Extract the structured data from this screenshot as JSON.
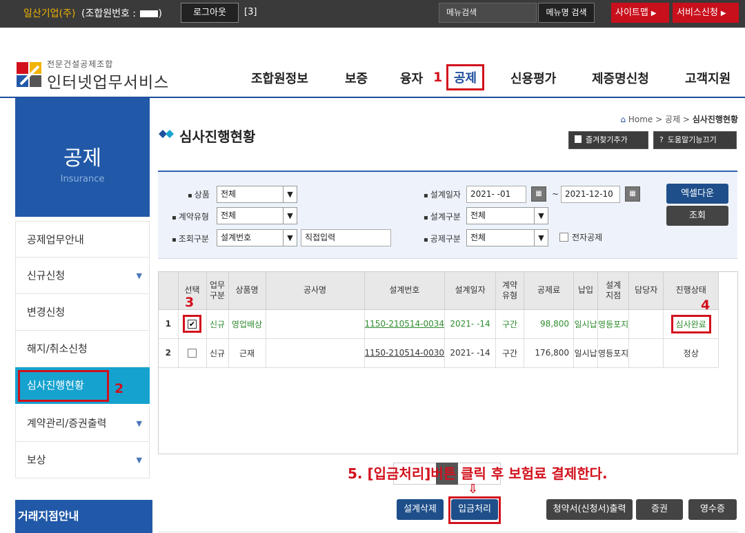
{
  "topbar": {
    "company": "일산기업(주)",
    "member_label": "(조합원번호 :",
    "logout": "로그아웃",
    "count": "[3]",
    "menu_search_placeholder": "메뉴검색",
    "menu_search_button": "메뉴명 검색",
    "sitemap": "사이트맵",
    "service": "서비스신청"
  },
  "logo": {
    "sub": "전문건설공제조합",
    "main": "인터넷업무서비스"
  },
  "gnav": [
    "조합원정보",
    "보증",
    "융자",
    "공제",
    "신용평가",
    "제증명신청",
    "고객지원"
  ],
  "annotations": {
    "n1": "1",
    "n2": "2",
    "n3": "3",
    "n4": "4",
    "instruction": "5. [입금처리]버튼 클릭 후 보험료 결제한다."
  },
  "sidebar": {
    "title": "공제",
    "subtitle": "Insurance",
    "items": [
      "공제업무안내",
      "신규신청",
      "변경신청",
      "해지/취소신청",
      "심사진행현황",
      "계약관리/증권출력",
      "보상"
    ],
    "branch": "거래지점안내"
  },
  "page": {
    "title": "심사진행현황",
    "breadcrumb_home": "Home",
    "breadcrumb_mid": "공제",
    "breadcrumb_current": "심사진행현황",
    "bookmark": "즐겨찾기추가",
    "help": "도움말기능끄기"
  },
  "search": {
    "product_label": "상품",
    "product_value": "전체",
    "contract_label": "계약유형",
    "contract_value": "전체",
    "query_label": "조회구분",
    "query_value": "설계번호",
    "query_input": "직접입력",
    "date_label": "설계일자",
    "date_from": "2021-  -01",
    "date_to": "2021-12-10",
    "design_label": "설계구분",
    "design_value": "전체",
    "insurance_label": "공제구분",
    "insurance_value": "전체",
    "electronic": "전자공제",
    "excel": "엑셀다운",
    "search": "조회"
  },
  "table": {
    "headers": [
      "선택",
      "업무\n구분",
      "상품명",
      "공사명",
      "설계번호",
      "설계일자",
      "계약\n유형",
      "공제료",
      "납입",
      "설계\n지점",
      "담당자",
      "진행상태"
    ],
    "rows": [
      {
        "no": "1",
        "type": "신규",
        "product": "영업배상",
        "project": "",
        "design_no": "1150-210514-0034",
        "date": "2021-   -14",
        "contract": "구간",
        "premium": "98,800",
        "payment": "일시납",
        "branch": "영등포지",
        "manager": "",
        "status": "심사완료",
        "checked": true
      },
      {
        "no": "2",
        "type": "신규",
        "product": "근재",
        "project": "",
        "design_no": "1150-210514-0030",
        "date": "2021-   -14",
        "contract": "구간",
        "premium": "176,800",
        "payment": "일시납",
        "branch": "영등포지",
        "manager": "",
        "status": "정상",
        "checked": false
      }
    ]
  },
  "buttons": {
    "delete": "설계삭제",
    "deposit": "입금처리",
    "print": "청약서(신청서)출력",
    "policy": "증권",
    "receipt": "영수증"
  },
  "colors": {
    "accent": "#2159a8",
    "red": "#d2101c",
    "active_lnb": "#15a2cf"
  }
}
